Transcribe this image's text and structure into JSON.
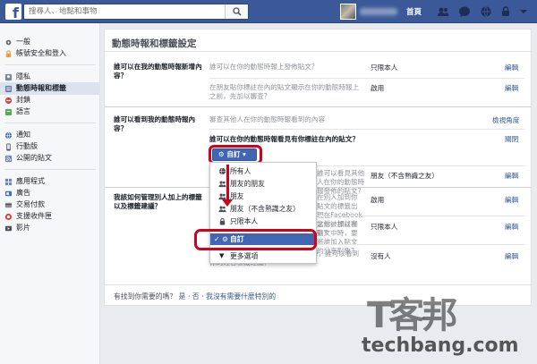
{
  "topbar": {
    "logo": "f",
    "search_placeholder": "搜尋人、地點和事物",
    "home": "首頁"
  },
  "leftnav": {
    "items": [
      {
        "label": "一般",
        "icon": "gear-icon",
        "color": "#6a6a6a"
      },
      {
        "label": "帳號安全和登入",
        "icon": "lock-icon",
        "color": "#e9a23b"
      },
      {
        "label": "隱私",
        "icon": "privacy-icon",
        "color": "#7b8799"
      },
      {
        "label": "動態時報和標籤",
        "icon": "timeline-icon",
        "color": "#6d84b4"
      },
      {
        "label": "封鎖",
        "icon": "block-icon",
        "color": "#d8453c"
      },
      {
        "label": "語言",
        "icon": "language-icon",
        "color": "#58a959"
      },
      {
        "label": "通知",
        "icon": "globe-icon",
        "color": "#4a6fb4"
      },
      {
        "label": "行動版",
        "icon": "mobile-icon",
        "color": "#4b4f56"
      },
      {
        "label": "公開的貼文",
        "icon": "rss-icon",
        "color": "#6d84b4"
      },
      {
        "label": "應用程式",
        "icon": "apps-icon",
        "color": "#6d84b4"
      },
      {
        "label": "廣告",
        "icon": "ads-icon",
        "color": "#4a6fb4"
      },
      {
        "label": "交易付款",
        "icon": "payments-icon",
        "color": "#8e8e8e"
      },
      {
        "label": "支援收件匣",
        "icon": "support-icon",
        "color": "#d8453c"
      },
      {
        "label": "影片",
        "icon": "video-icon",
        "color": "#4b4f56"
      }
    ]
  },
  "main": {
    "title": "動態時報和標籤設定",
    "section1": {
      "question": "誰可以在我的動態時報新增內容？",
      "rows": [
        {
          "desc": "誰可以在你的動態時報上發佈貼文？",
          "value": "只限本人",
          "edit": "編輯"
        },
        {
          "desc": "在朋友貼你標註在內的貼文顯示在你的動態時報上之前，先加以審查？",
          "value": "啟用",
          "edit": "編輯"
        }
      ]
    },
    "section2": {
      "question": "誰可以看到我的動態時報內容？",
      "row1": {
        "desc": "審查其他人在你的動態時報看到的內容",
        "edit": "檢視角度"
      },
      "expanded_question": "誰可以在你的動態時報看見有你標註在內的貼文？",
      "close": "關閉",
      "button": "自訂",
      "row2": {
        "desc": "誰可以看見其他人在你的動態時報發佈的貼文？",
        "value": "朋友（不含熟識之友）",
        "edit": "編輯"
      }
    },
    "section3": {
      "question": "我該如何管理別人加上的標籤以及標籤建議？",
      "rows": [
        {
          "desc": "在別人加到你貼文的標籤出現在Facebook之前，加以審查？",
          "value": "啟用",
          "edit": "編輯"
        },
        {
          "desc": "當你被標註在貼文中時，要將誰加入貼文的分享對象？",
          "value": "只限本人",
          "edit": "編輯"
        },
        {
          "desc": "當系統偵測到相片中有類似你的人時，誰可以看到你的姓名標籤建議？",
          "value": "沒有人",
          "edit": "編輯"
        }
      ]
    },
    "dropdown": {
      "items": [
        "所有人",
        "朋友的朋友",
        "朋友",
        "朋友（不含熟識之友）",
        "只限本人",
        "自訂",
        "更多選項"
      ]
    }
  },
  "footer": {
    "question": "有找到你需要的嗎？",
    "yes": "是",
    "sep1": "·",
    "no": "否",
    "sep2": "·",
    "no_need": "我沒有需要什麼特別的"
  },
  "watermark": {
    "brand_zh": "T客邦",
    "brand_en": "techbang.com"
  }
}
